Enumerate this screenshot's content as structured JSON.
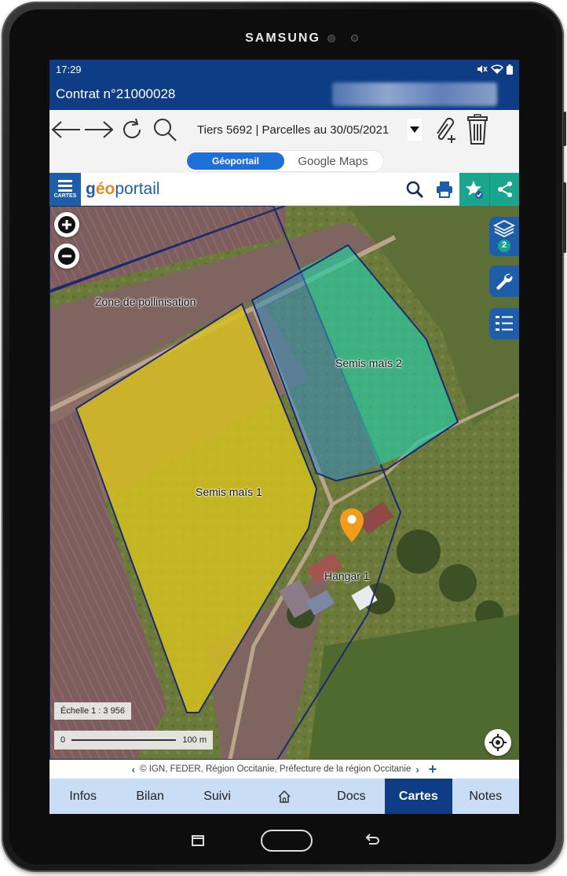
{
  "device": {
    "brand": "SAMSUNG"
  },
  "status_bar": {
    "time": "17:29",
    "icons": [
      "mute-icon",
      "wifi-icon",
      "battery-icon"
    ]
  },
  "app_bar": {
    "title": "Contrat n°21000028"
  },
  "toolbar": {
    "filter_label": "Tiers 5692 | Parcelles au 30/05/2021",
    "icons": [
      "back-arrow-icon",
      "forward-arrow-icon",
      "refresh-icon",
      "search-icon",
      "dropdown-arrow-icon",
      "attach-icon",
      "trash-icon"
    ]
  },
  "map_source": {
    "options": [
      "Géoportail",
      "Google Maps"
    ],
    "selected": "Géoportail"
  },
  "geoportail_bar": {
    "menu_label": "CARTES",
    "logo_g": "g",
    "logo_o": "éo",
    "logo_rest": "portail"
  },
  "map": {
    "labels": {
      "zone": "Zone de pollinisation",
      "field1": "Semis maïs 1",
      "field2": "Semis maïs 2",
      "hangar": "Hangar 1"
    },
    "layers_count": "2",
    "scale_text": "Échelle 1 : 3 956",
    "scale_start": "0",
    "scale_end": "100 m",
    "colors": {
      "field1": "#d8c21e",
      "field2_green": "#2bc7a0",
      "field2_blue": "#3a8ab8",
      "marker": "#f39b1b",
      "outline": "#1a2a6c"
    }
  },
  "attribution": {
    "text": "© IGN,  FEDER,  Région Occitanie,  Préfecture de la région Occitanie"
  },
  "bottom_nav": {
    "tabs": [
      {
        "label": "Infos"
      },
      {
        "label": "Bilan"
      },
      {
        "label": "Suivi"
      },
      {
        "label": ""
      },
      {
        "label": "Docs"
      },
      {
        "label": "Cartes"
      },
      {
        "label": "Notes"
      }
    ],
    "active": "Cartes"
  }
}
